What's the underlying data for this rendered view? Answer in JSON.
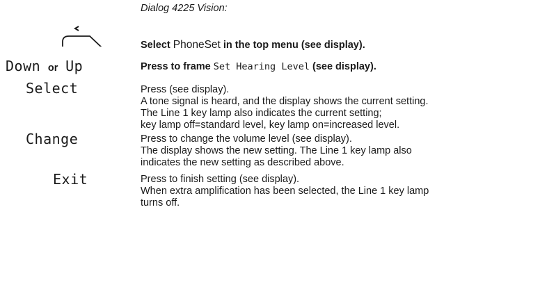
{
  "subtitle": "Dialog 4225 Vision:",
  "icons": {
    "softkey": "softkey-icon"
  },
  "steps": {
    "select_phoneset": {
      "pre": "Select",
      "item": "PhoneSet",
      "post": "in the top menu (see display)."
    },
    "down_up": {
      "key1": "Down",
      "or": "or",
      "key2": "Up",
      "pre": "Press to frame",
      "item": "Set Hearing Level",
      "post": "(see display)."
    },
    "select": {
      "key": "Select",
      "instruction": "Press (see display).",
      "desc1": "A tone signal is heard, and the display shows the current setting.",
      "desc2": "The Line 1 key lamp also indicates the current setting;",
      "desc3": "key lamp off=standard level, key lamp on=increased level."
    },
    "change": {
      "key": "Change",
      "instruction": "Press to change the volume level (see display).",
      "desc1": "The display shows the new setting. The Line 1 key lamp also",
      "desc2": "indicates the new setting as described above."
    },
    "exit": {
      "key": "Exit",
      "instruction": "Press to finish setting (see display).",
      "desc1": "When extra amplification has been selected, the Line 1 key lamp",
      "desc2": "turns off."
    }
  }
}
